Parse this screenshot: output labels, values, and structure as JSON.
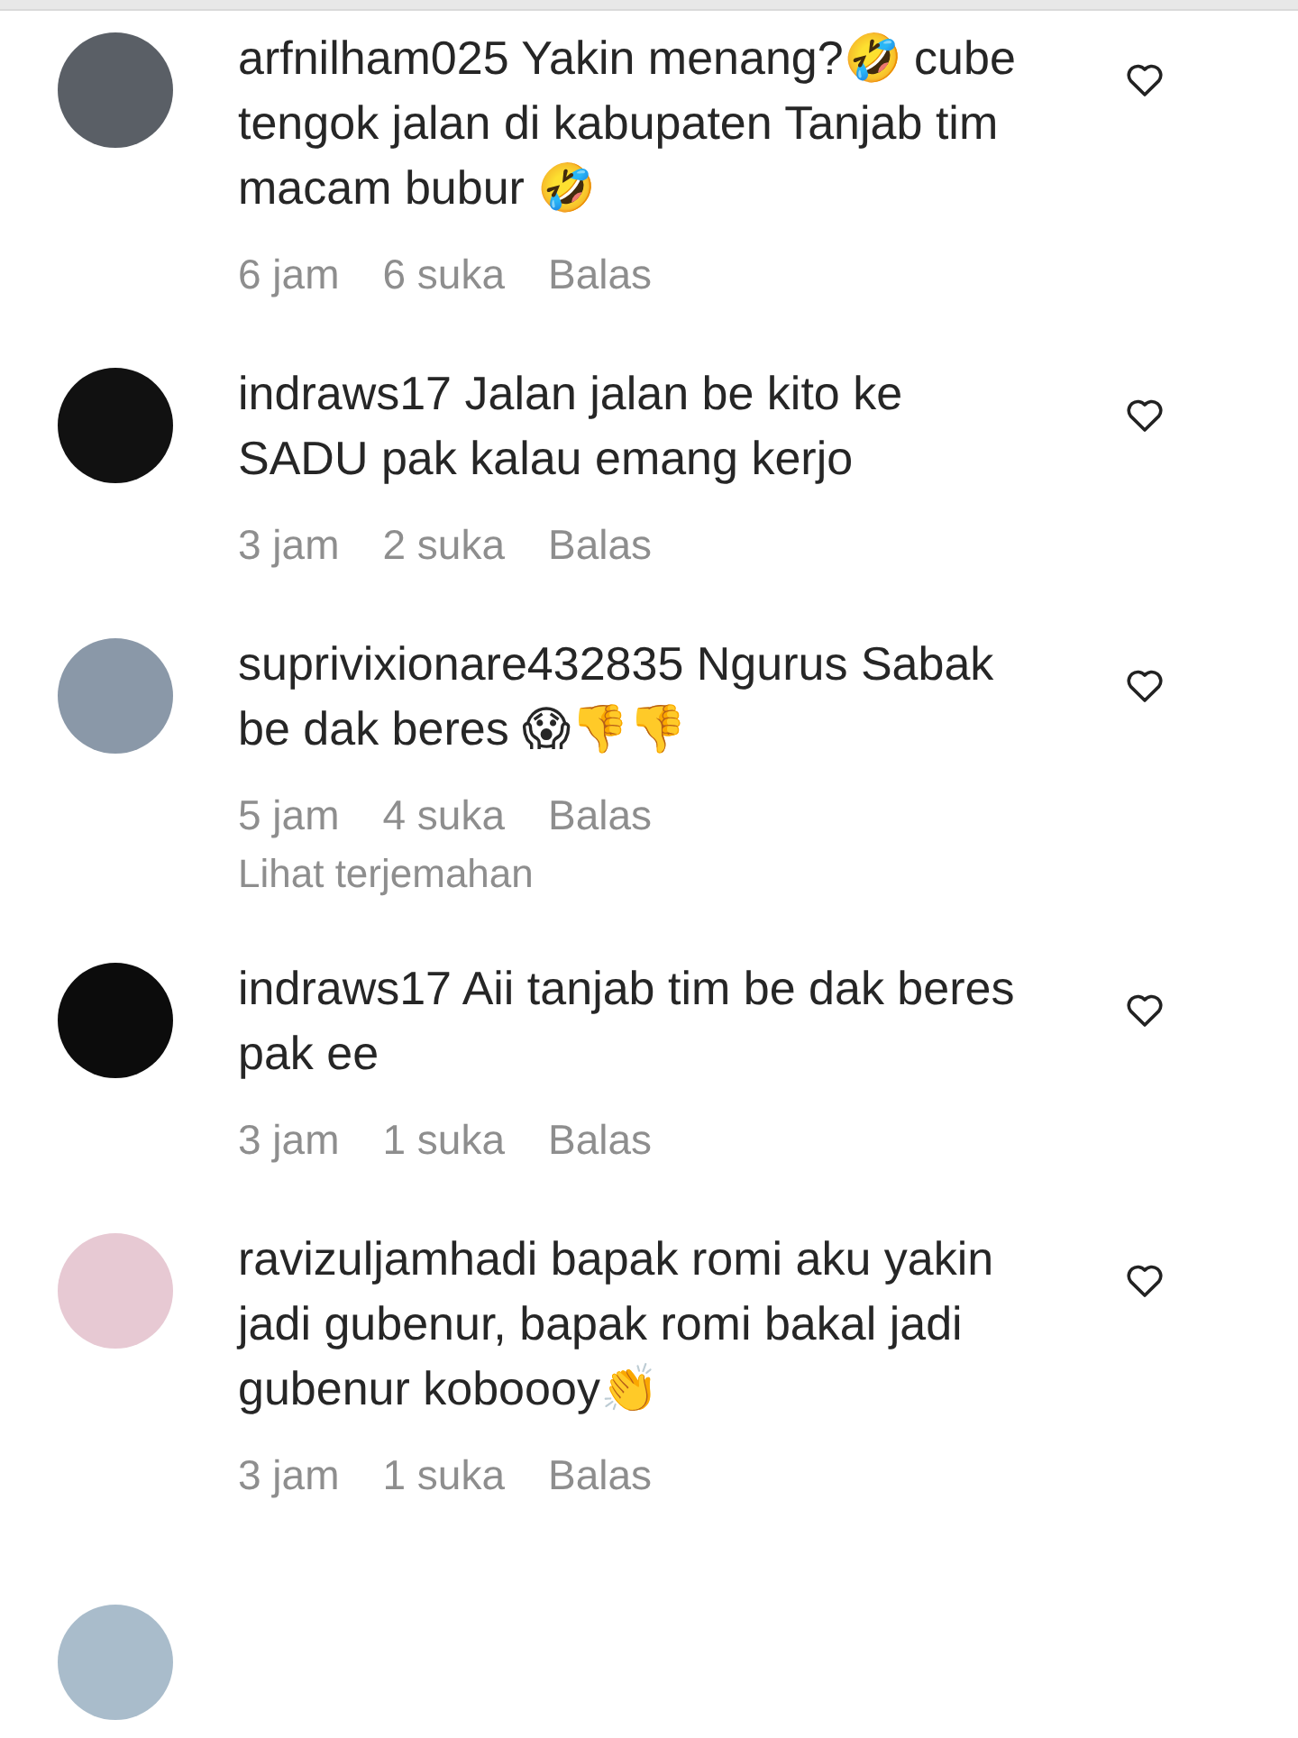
{
  "comments": [
    {
      "username": "arfnilham025",
      "text": "Yakin menang?🤣 cube tengok jalan di kabupaten Tanjab tim macam bubur 🤣",
      "time": "6 jam",
      "likes": "6 suka",
      "reply": "Balas",
      "liked": false
    },
    {
      "username": "indraws17",
      "text": "Jalan jalan be kito ke SADU pak kalau emang kerjo",
      "time": "3 jam",
      "likes": "2 suka",
      "reply": "Balas",
      "liked": false
    },
    {
      "username": "suprivixionare432835",
      "text": "Ngurus Sabak be dak beres 😱👎👎",
      "time": "5 jam",
      "likes": "4 suka",
      "reply": "Balas",
      "translate": "Lihat terjemahan",
      "liked": false
    },
    {
      "username": "indraws17",
      "text": "Aii tanjab tim be dak beres pak ee",
      "time": "3 jam",
      "likes": "1 suka",
      "reply": "Balas",
      "liked": false
    },
    {
      "username": "ravizuljamhadi",
      "text": "bapak romi aku yakin jadi gubenur, bapak romi bakal jadi gubenur koboooy👏",
      "time": "3 jam",
      "likes": "1 suka",
      "reply": "Balas",
      "liked": false
    }
  ]
}
